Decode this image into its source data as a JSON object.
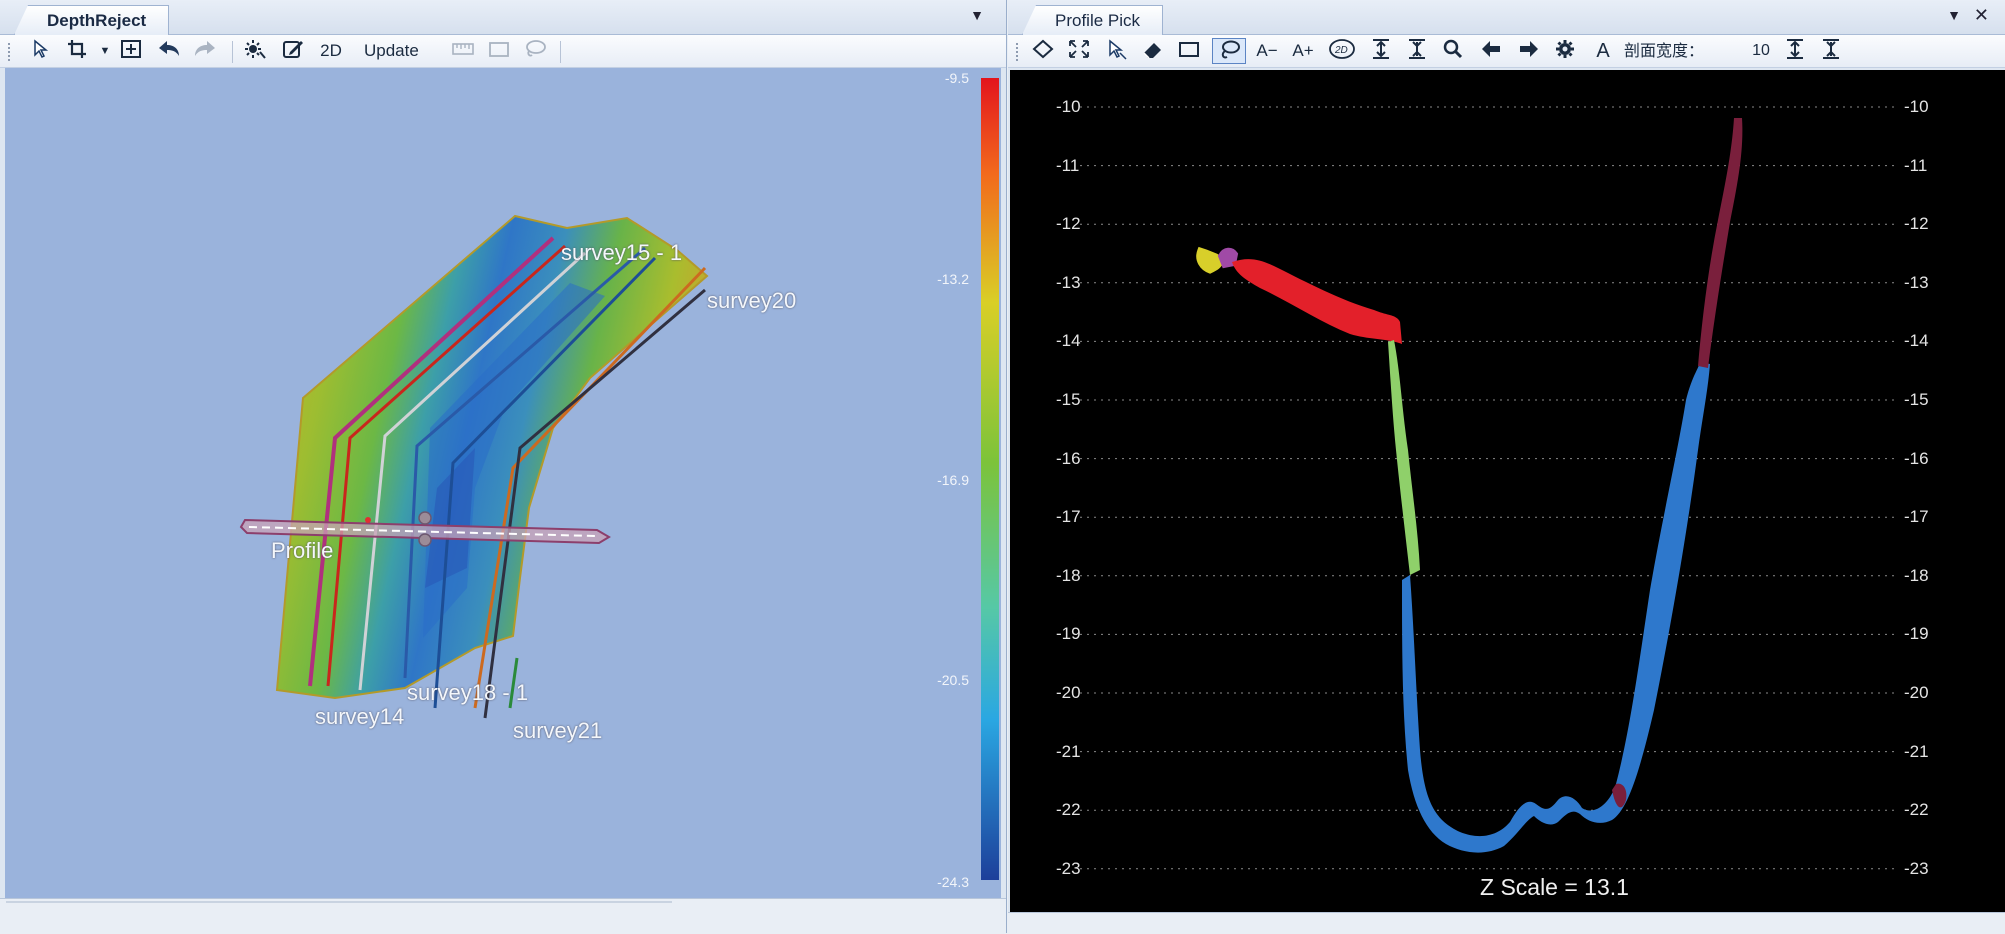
{
  "left_panel": {
    "tab_title": "DepthReject",
    "toolbar": {
      "btn_2d": "2D",
      "btn_update": "Update"
    },
    "labels": {
      "survey15": "survey15 - 1",
      "survey20": "survey20",
      "profile": "Profile",
      "survey18": "survey18 - 1",
      "survey14": "survey14",
      "survey21": "survey21"
    },
    "colorbar_ticks": [
      "-9.5",
      "-13.2",
      "-16.9",
      "-20.5",
      "-24.3"
    ]
  },
  "right_panel": {
    "tab_title": "Profile Pick",
    "toolbar": {
      "font_smaller": "A−",
      "font_larger": "A+",
      "font_a": "A",
      "width_label": "剖面宽度：",
      "width_value": "10"
    },
    "z_ticks": [
      "-10",
      "-11",
      "-12",
      "-13",
      "-14",
      "-15",
      "-16",
      "-17",
      "-18",
      "-19",
      "-20",
      "-21",
      "-22",
      "-23"
    ],
    "z_scale_text": "Z Scale = 13.1"
  },
  "colors": {
    "background_3d": "#9ab3dc",
    "profile_bg": "#000000",
    "seg_yellow": "#d8cf2a",
    "seg_purple": "#a04aa6",
    "seg_red": "#e3202a",
    "seg_green": "#8fd06a",
    "seg_blue": "#2e78cc",
    "seg_maroon": "#7a1f3c"
  }
}
